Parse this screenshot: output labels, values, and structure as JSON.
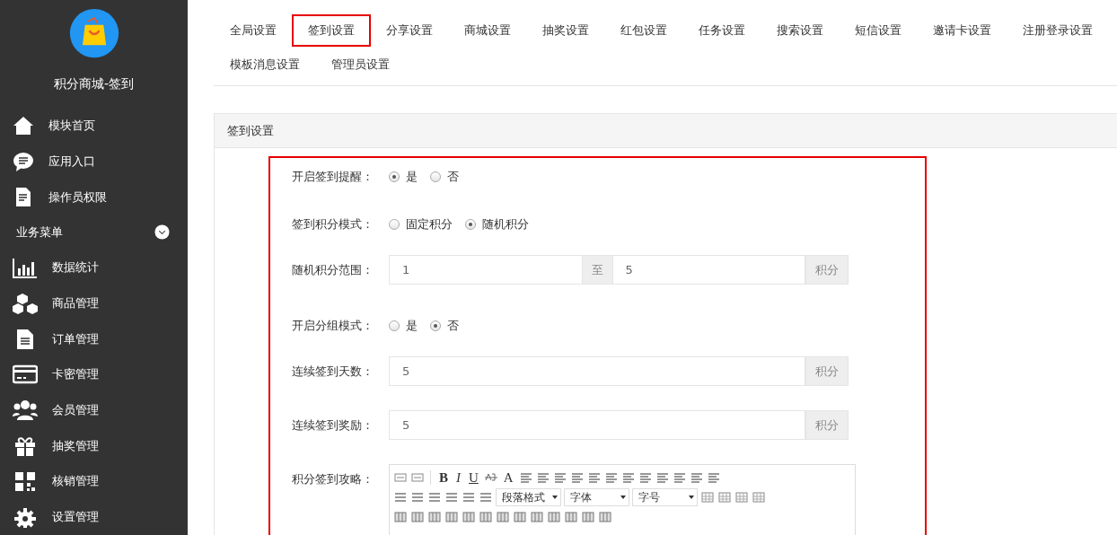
{
  "sidebar": {
    "title": "积分商城-签到",
    "items": [
      {
        "label": "模块首页"
      },
      {
        "label": "应用入口"
      },
      {
        "label": "操作员权限"
      }
    ],
    "section": {
      "label": "业务菜单",
      "expanded": true
    },
    "section_items": [
      {
        "label": "数据统计"
      },
      {
        "label": "商品管理"
      },
      {
        "label": "订单管理"
      },
      {
        "label": "卡密管理"
      },
      {
        "label": "会员管理"
      },
      {
        "label": "抽奖管理"
      },
      {
        "label": "核销管理"
      },
      {
        "label": "设置管理"
      }
    ]
  },
  "tabs": [
    {
      "label": "全局设置",
      "selected": false
    },
    {
      "label": "签到设置",
      "selected": true
    },
    {
      "label": "分享设置",
      "selected": false
    },
    {
      "label": "商城设置",
      "selected": false
    },
    {
      "label": "抽奖设置",
      "selected": false
    },
    {
      "label": "红包设置",
      "selected": false
    },
    {
      "label": "任务设置",
      "selected": false
    },
    {
      "label": "搜索设置",
      "selected": false
    },
    {
      "label": "短信设置",
      "selected": false
    },
    {
      "label": "邀请卡设置",
      "selected": false
    },
    {
      "label": "注册登录设置",
      "selected": false
    },
    {
      "label": "模板消息设置",
      "selected": false
    },
    {
      "label": "管理员设置",
      "selected": false
    }
  ],
  "panel": {
    "title": "签到设置",
    "fields": [
      {
        "kind": "radio",
        "label": "开启签到提醒：",
        "options": [
          {
            "label": "是",
            "selected": true
          },
          {
            "label": "否",
            "selected": false
          }
        ]
      },
      {
        "kind": "radio",
        "label": "签到积分模式：",
        "options": [
          {
            "label": "固定积分",
            "selected": false
          },
          {
            "label": "随机积分",
            "selected": true
          }
        ]
      },
      {
        "kind": "range",
        "label": "随机积分范围：",
        "from": "1",
        "separator": "至",
        "to": "5",
        "unit": "积分"
      },
      {
        "kind": "radio",
        "label": "开启分组模式：",
        "options": [
          {
            "label": "是",
            "selected": false
          },
          {
            "label": "否",
            "selected": true
          }
        ]
      },
      {
        "kind": "input",
        "label": "连续签到天数：",
        "value": "5",
        "unit": "积分"
      },
      {
        "kind": "input",
        "label": "连续签到奖励：",
        "value": "5",
        "unit": "积分"
      },
      {
        "kind": "editor",
        "label": "积分签到攻略：",
        "format_buttons": [
          "B",
          "I",
          "U"
        ],
        "font_color_button": "A",
        "selects": [
          "段落格式",
          "字体",
          "字号"
        ]
      }
    ]
  }
}
